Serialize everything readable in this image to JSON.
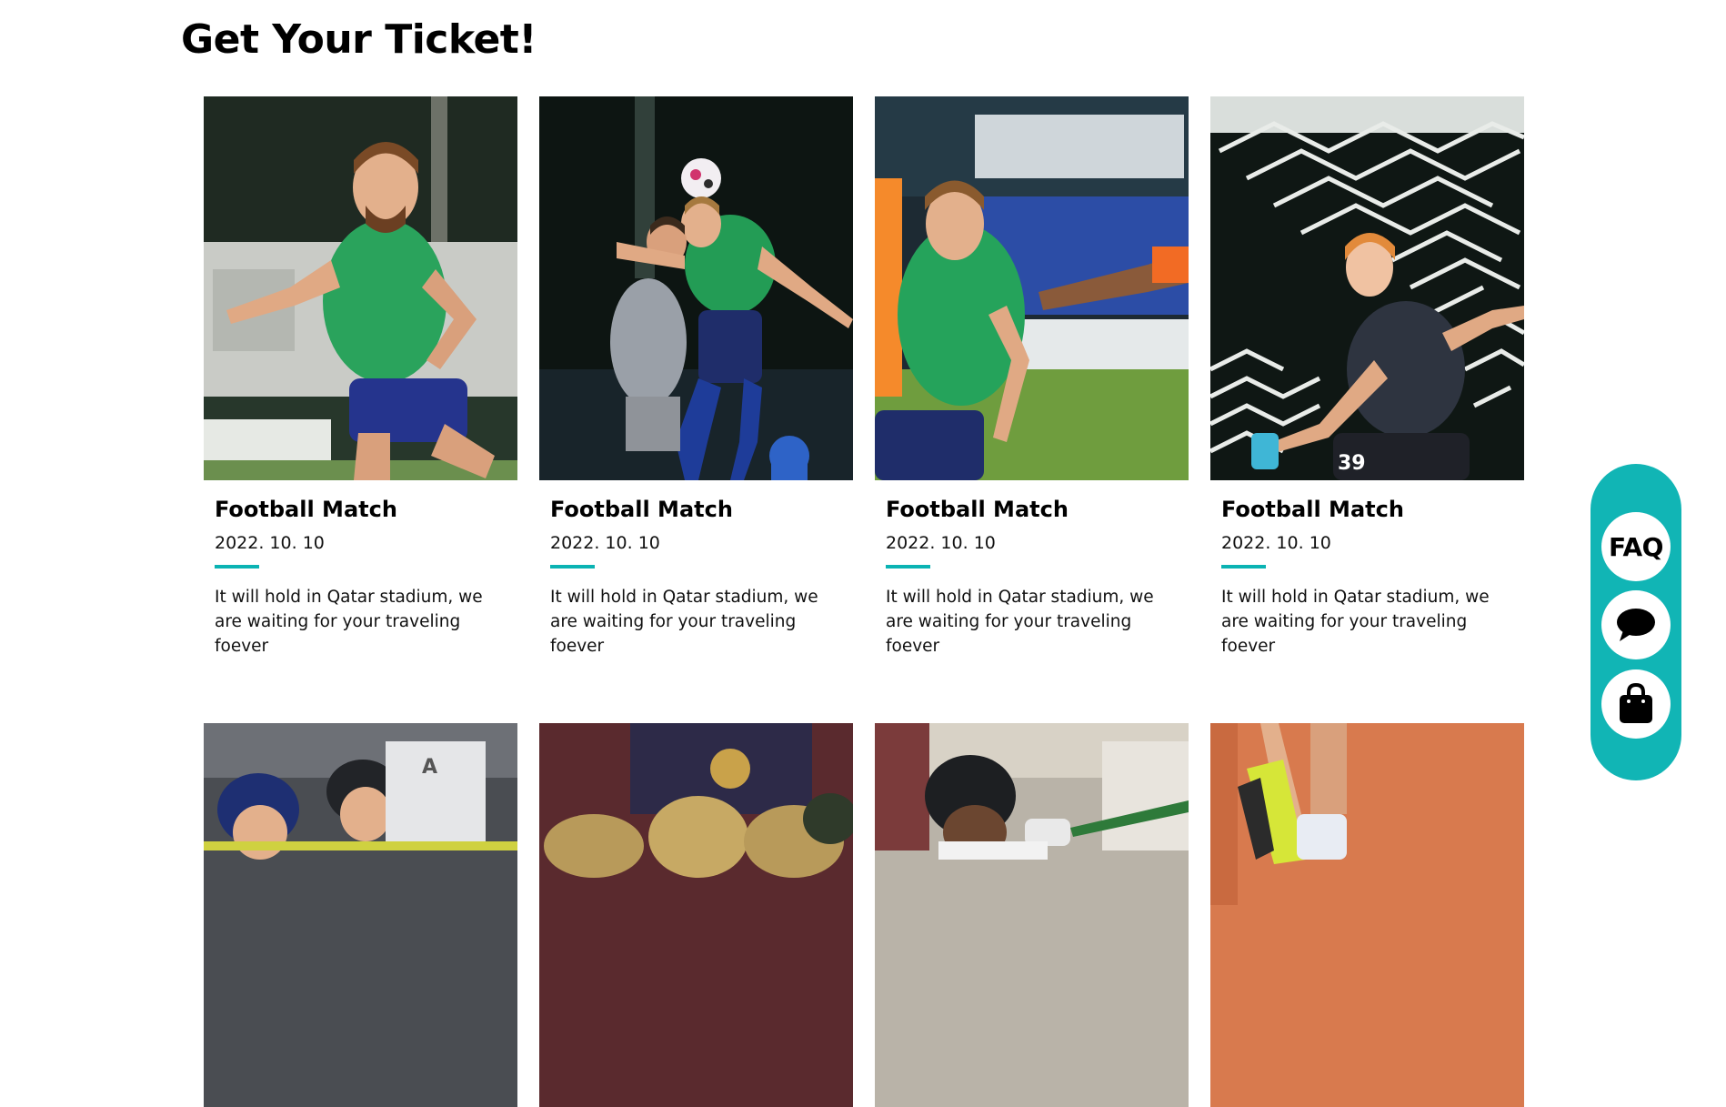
{
  "page": {
    "title": "Get Your Ticket!"
  },
  "cards": [
    {
      "title": "Football Match",
      "date": "2022. 10. 10",
      "description": "It will hold in Qatar stadium, we are waiting for your traveling foever"
    },
    {
      "title": "Football Match",
      "date": "2022. 10. 10",
      "description": "It will hold in Qatar stadium, we are waiting for your traveling foever"
    },
    {
      "title": "Football Match",
      "date": "2022. 10. 10",
      "description": "It will hold in Qatar stadium, we are waiting for your traveling foever"
    },
    {
      "title": "Football Match",
      "date": "2022. 10. 10",
      "description": "It will hold in Qatar stadium, we are waiting for your traveling foever"
    }
  ],
  "side_menu": {
    "faq_label": "FAQ",
    "chat_icon": "speech-bubble-icon",
    "bag_icon": "shopping-bag-icon"
  },
  "colors": {
    "accent": "#11b5b5",
    "divider": "#0bb3b3"
  }
}
